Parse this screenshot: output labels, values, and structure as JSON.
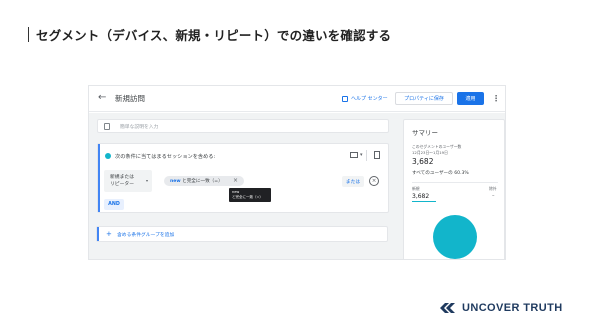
{
  "slide": {
    "title": "セグメント（デバイス、新規・リピート）での違いを確認する"
  },
  "topbar": {
    "segment_name": "新規訪問",
    "help_label": "ヘルプ センター",
    "save_audience_label": "プロパティに保存",
    "apply_label": "適用"
  },
  "editor": {
    "description_placeholder": "簡単な説明を入力",
    "condition_text": "次の条件に当てはまるセッションを含める:",
    "dimension_label_line1": "新規または",
    "dimension_label_line2": "リピーター",
    "chip_value": "new",
    "chip_rest": " と完全に一致（=）",
    "chip_close": "×",
    "or_label": "または",
    "and_label": "AND",
    "add_group_label": "含める条件グループを追加",
    "tooltip_line1": "new",
    "tooltip_line2": "と完全に一致（=）"
  },
  "summary": {
    "title": "サマリー",
    "desc_line1": "このセグメントのユーザー数",
    "desc_line2": "12月23日～1月19日",
    "user_count": "3,682",
    "share_text": "すべてのユーザーの 60.3%",
    "legend_left": "新規",
    "legend_right": "除外",
    "legend_value": "3,682",
    "legend_dash": "–",
    "pie_color": "#12b5cb"
  },
  "brand": {
    "logo_text": "UNCOVER TRUTH",
    "color": "#1f3a5f"
  }
}
